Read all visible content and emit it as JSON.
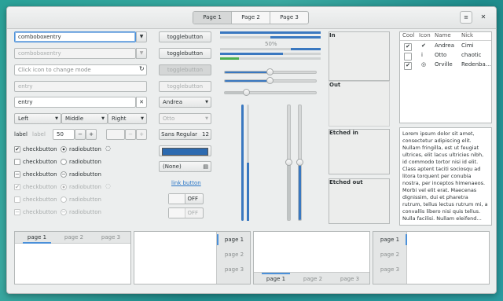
{
  "header": {
    "tabs": [
      "Page 1",
      "Page 2",
      "Page 3"
    ],
    "menu_icon": "hamburger-icon",
    "close_icon": "close-icon"
  },
  "col1": {
    "combo1": "comboboxentry",
    "combo2": "comboboxentry",
    "mode_placeholder": "Click icon to change mode",
    "entry_dis": "entry",
    "entry": "entry",
    "seg": [
      "Left",
      "Middle",
      "Right"
    ],
    "spin_label": "label",
    "spin_label2": "label",
    "spin_value": "50",
    "minus": "−",
    "plus": "+",
    "checks": [
      "checkbutton",
      "checkbutton",
      "checkbutton",
      "checkbutton",
      "checkbutton",
      "checkbutton"
    ],
    "radios": [
      "radiobutton",
      "radiobutton",
      "radiobutton",
      "radiobutton",
      "radiobutton",
      "radiobutton"
    ]
  },
  "col2": {
    "toggles": [
      "togglebutton",
      "togglebutton",
      "togglebutton",
      "togglebutton"
    ],
    "combo_andrea": "Andrea",
    "combo_otto": "Otto",
    "font": "Sans Regular",
    "font_size": "12",
    "color": "#2c6ab0",
    "file": "(None)",
    "link": "link button",
    "off1": "OFF",
    "off2": "OFF"
  },
  "col3": {
    "progress_label": "50%",
    "progress_values": [
      1.0,
      0.5,
      0.3,
      0.2
    ]
  },
  "frames": [
    "In",
    "Out",
    "Etched in",
    "Etched out"
  ],
  "tree": {
    "headers": [
      "Cool",
      "Icon",
      "Name",
      "Nick"
    ],
    "rows": [
      {
        "cool": "✔",
        "icon": "✔",
        "name": "Andrea",
        "nick": "Cimi"
      },
      {
        "cool": "",
        "icon": "i",
        "name": "Otto",
        "nick": "chaotic"
      },
      {
        "cool": "✔",
        "icon": "◎",
        "name": "Orville",
        "nick": "Redenba…"
      }
    ]
  },
  "textview": "Lorem ipsum dolor sit amet, consectetur adipiscing elit. Nullam fringilla, est ut feugiat ultrices, elit lacus ultricies nibh, id commodo tortor nisi id elit. Class aptent taciti sociosqu ad litora torquent per conubia nostra, per inceptos himenaeos. Morbi vel elit erat. Maecenas dignissim, dui et pharetra rutrum, tellus lectus rutrum mi, a convallis libero nisi quis tellus. Nulla facilisi. Nullam eleifend…",
  "notebooks": {
    "tabs": [
      "page 1",
      "page 2",
      "page 3"
    ]
  }
}
